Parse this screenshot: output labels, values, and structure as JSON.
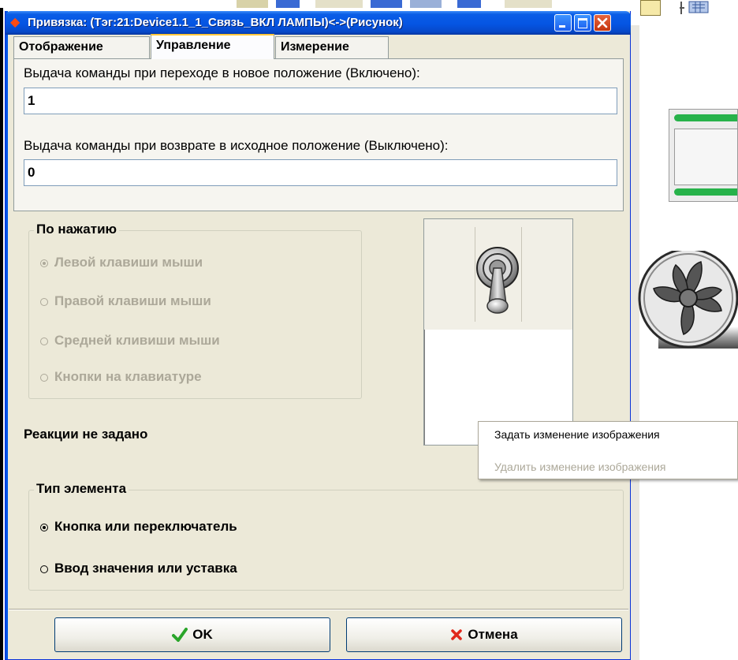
{
  "window": {
    "title": "Привязка: (Тэг:21:Device1.1_1_Связь_ВКЛ ЛАМПЫ)<->(Рисунок)",
    "app_icon": "diamond-icon"
  },
  "tabs": [
    {
      "label": "Отображение",
      "active": false
    },
    {
      "label": "Управление",
      "active": true
    },
    {
      "label": "Измерение",
      "active": false
    }
  ],
  "control": {
    "on_label": "Выдача команды при переходе в новое положение (Включено):",
    "on_value": "1",
    "off_label": "Выдача команды при возврате в исходное положение (Выключено):",
    "off_value": "0"
  },
  "press_group": {
    "title": "По нажатию",
    "options": [
      {
        "label": "Левой клавиши мыши",
        "selected": true
      },
      {
        "label": "Правой клавиши мыши",
        "selected": false
      },
      {
        "label": "Средней кливиши мыши",
        "selected": false
      },
      {
        "label": "Кнопки на клавиатуре",
        "selected": false
      }
    ],
    "enabled": false
  },
  "reaction_text": "Реакции не задано",
  "type_group": {
    "title": "Тип элемента",
    "options": [
      {
        "label": "Кнопка или переключатель",
        "selected": true
      },
      {
        "label": "Ввод значения или уставка",
        "selected": false
      }
    ]
  },
  "context_menu": {
    "items": [
      {
        "label": "Задать изменение изображения",
        "enabled": true
      },
      {
        "label": "Удалить изменение изображения",
        "enabled": false
      }
    ]
  },
  "buttons": {
    "ok": "OK",
    "cancel": "Отмена"
  },
  "colors": {
    "titlebar": "#0555e3",
    "dialog_bg": "#ece9d8",
    "ok_check": "#2aa52a",
    "cancel_x": "#e0281b",
    "disabled_text": "#aca899"
  }
}
